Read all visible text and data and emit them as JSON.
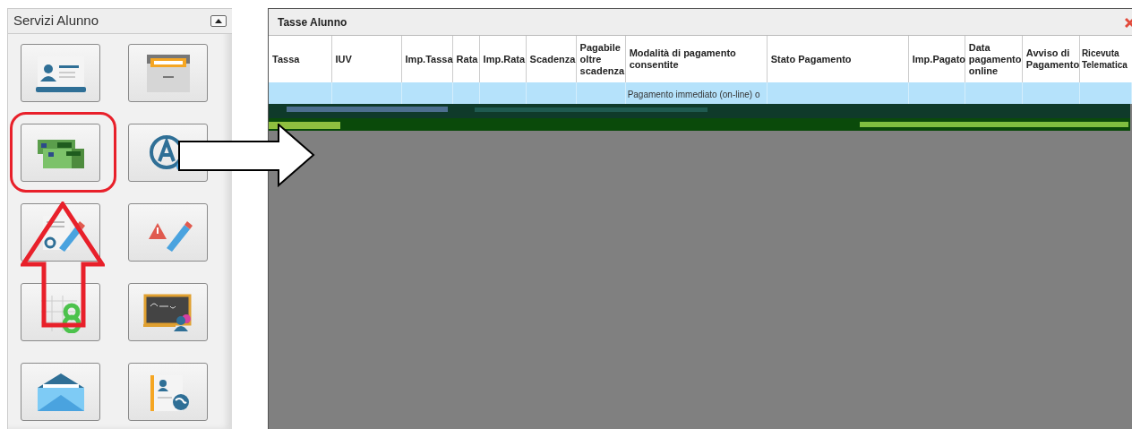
{
  "panel": {
    "title": "Servizi Alunno",
    "tiles": [
      {
        "kind": "id-card"
      },
      {
        "kind": "folder"
      },
      {
        "kind": "money"
      },
      {
        "kind": "letter-a"
      },
      {
        "kind": "grade-pencil"
      },
      {
        "kind": "warning-pencil"
      },
      {
        "kind": "grid-eight"
      },
      {
        "kind": "blackboard"
      },
      {
        "kind": "envelope"
      },
      {
        "kind": "profile-globe"
      }
    ]
  },
  "annotations": [
    {
      "kind": "rounded-frame"
    },
    {
      "kind": "up-arrow"
    },
    {
      "kind": "right-arrow"
    }
  ],
  "window": {
    "title": "Tasse Alunno",
    "columns": [
      "Tassa",
      "IUV",
      "Imp.Tassa",
      "Rata",
      "Imp.Rata",
      "Scadenza",
      "Pagabile oltre scadenza",
      "Modalità di pagamento consentite",
      "Stato Pagamento",
      "Imp.Pagato",
      "Data pagamento online",
      "Avviso di Pagamento",
      "Ricevuta Telematica"
    ],
    "rows": [
      {
        "selected": true,
        "payment_methods": "Pagamento immediato (on-line) o"
      }
    ]
  }
}
